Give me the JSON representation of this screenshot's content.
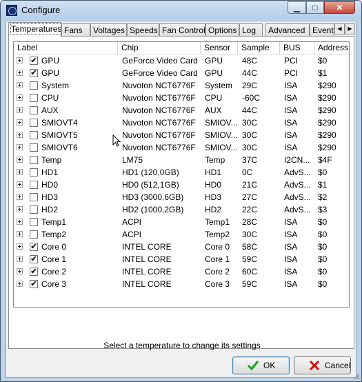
{
  "window": {
    "title": "Configure",
    "app_icon": "app-icon"
  },
  "caption": {
    "minimize": "▁",
    "maximize": "□",
    "close": "✕"
  },
  "tabs": [
    "Temperatures",
    "Fans",
    "Voltages",
    "Speeds",
    "Fan Control",
    "Options",
    "Log",
    "Advanced",
    "Events"
  ],
  "tab_scroll": {
    "left": "◀",
    "right": "▶"
  },
  "columns": [
    "Label",
    "Chip",
    "Sensor",
    "Sample",
    "BUS",
    "Address"
  ],
  "rows": [
    {
      "checked": true,
      "label": "GPU",
      "chip": "GeForce Video Card",
      "sensor": "GPU",
      "sample": "48C",
      "bus": "PCI",
      "address": "$0"
    },
    {
      "checked": true,
      "label": "GPU",
      "chip": "GeForce Video Card",
      "sensor": "GPU",
      "sample": "44C",
      "bus": "PCI",
      "address": "$1"
    },
    {
      "checked": false,
      "label": "System",
      "chip": "Nuvoton NCT6776F",
      "sensor": "System",
      "sample": "29C",
      "bus": "ISA",
      "address": "$290"
    },
    {
      "checked": false,
      "label": "CPU",
      "chip": "Nuvoton NCT6776F",
      "sensor": "CPU",
      "sample": "-60C",
      "bus": "ISA",
      "address": "$290"
    },
    {
      "checked": false,
      "label": "AUX",
      "chip": "Nuvoton NCT6776F",
      "sensor": "AUX",
      "sample": "44C",
      "bus": "ISA",
      "address": "$290"
    },
    {
      "checked": false,
      "label": "SMIOVT4",
      "chip": "Nuvoton NCT6776F",
      "sensor": "SMIOV...",
      "sample": "30C",
      "bus": "ISA",
      "address": "$290"
    },
    {
      "checked": false,
      "label": "SMIOVT5",
      "chip": "Nuvoton NCT6776F",
      "sensor": "SMIOV...",
      "sample": "30C",
      "bus": "ISA",
      "address": "$290"
    },
    {
      "checked": false,
      "label": "SMIOVT6",
      "chip": "Nuvoton NCT6776F",
      "sensor": "SMIOV...",
      "sample": "30C",
      "bus": "ISA",
      "address": "$290"
    },
    {
      "checked": false,
      "label": "Temp",
      "chip": "LM75",
      "sensor": "Temp",
      "sample": "37C",
      "bus": "I2CN...",
      "address": "$4F"
    },
    {
      "checked": false,
      "label": "HD1",
      "chip": "HD1 (120,0GB)",
      "sensor": "HD1",
      "sample": "0C",
      "bus": "AdvS...",
      "address": "$0"
    },
    {
      "checked": false,
      "label": "HD0",
      "chip": "HD0 (512,1GB)",
      "sensor": "HD0",
      "sample": "21C",
      "bus": "AdvS...",
      "address": "$1"
    },
    {
      "checked": false,
      "label": "HD3",
      "chip": "HD3 (3000,6GB)",
      "sensor": "HD3",
      "sample": "27C",
      "bus": "AdvS...",
      "address": "$2"
    },
    {
      "checked": false,
      "label": "HD2",
      "chip": "HD2 (1000,2GB)",
      "sensor": "HD2",
      "sample": "22C",
      "bus": "AdvS...",
      "address": "$3"
    },
    {
      "checked": false,
      "label": "Temp1",
      "chip": "ACPI",
      "sensor": "Temp1",
      "sample": "28C",
      "bus": "ISA",
      "address": "$0"
    },
    {
      "checked": false,
      "label": "Temp2",
      "chip": "ACPI",
      "sensor": "Temp2",
      "sample": "30C",
      "bus": "ISA",
      "address": "$0"
    },
    {
      "checked": true,
      "label": "Core 0",
      "chip": "INTEL CORE",
      "sensor": "Core 0",
      "sample": "58C",
      "bus": "ISA",
      "address": "$0"
    },
    {
      "checked": true,
      "label": "Core 1",
      "chip": "INTEL CORE",
      "sensor": "Core 1",
      "sample": "59C",
      "bus": "ISA",
      "address": "$0"
    },
    {
      "checked": true,
      "label": "Core 2",
      "chip": "INTEL CORE",
      "sensor": "Core 2",
      "sample": "60C",
      "bus": "ISA",
      "address": "$0"
    },
    {
      "checked": true,
      "label": "Core 3",
      "chip": "INTEL CORE",
      "sensor": "Core 3",
      "sample": "59C",
      "bus": "ISA",
      "address": "$0"
    }
  ],
  "check_glyph": "✔",
  "status_text": "Select a temperature to change its settings",
  "buttons": {
    "ok": {
      "label": "OK",
      "icon": "checkmark-icon",
      "color": "#1f9a1f"
    },
    "cancel": {
      "label": "Cancel",
      "icon": "red-x-icon",
      "color": "#cc1111"
    }
  }
}
